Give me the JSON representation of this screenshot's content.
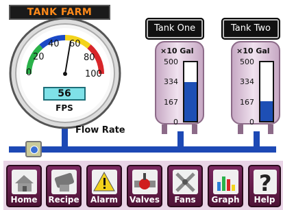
{
  "header": {
    "title": "TANK FARM"
  },
  "tanks": [
    {
      "button_label": "Tank One",
      "unit": "×10 Gal",
      "ticks": [
        "500",
        "334",
        "167",
        "0"
      ],
      "level_fraction": 0.66,
      "fill_color": "#1e4fb5"
    },
    {
      "button_label": "Tank Two",
      "unit": "×10 Gal",
      "ticks": [
        "500",
        "334",
        "167",
        "0"
      ],
      "level_fraction": 0.34,
      "fill_color": "#1e4fb5"
    }
  ],
  "gauge": {
    "scale": [
      "0",
      "20",
      "40",
      "60",
      "80",
      "100"
    ],
    "value": "56",
    "unit": "FPS",
    "label": "Flow Rate",
    "colors": {
      "green": "#2bb24a",
      "yellow": "#f3d31c",
      "red": "#d8262a",
      "blue": "#1b4ac7"
    }
  },
  "nav": [
    {
      "label": "Home",
      "icon": "home-icon"
    },
    {
      "label": "Recipe",
      "icon": "recipe-icon"
    },
    {
      "label": "Alarm",
      "icon": "alarm-icon"
    },
    {
      "label": "Valves",
      "icon": "valve-icon"
    },
    {
      "label": "Fans",
      "icon": "fan-icon"
    },
    {
      "label": "Graph",
      "icon": "graph-icon"
    },
    {
      "label": "Help",
      "icon": "help-icon"
    }
  ]
}
